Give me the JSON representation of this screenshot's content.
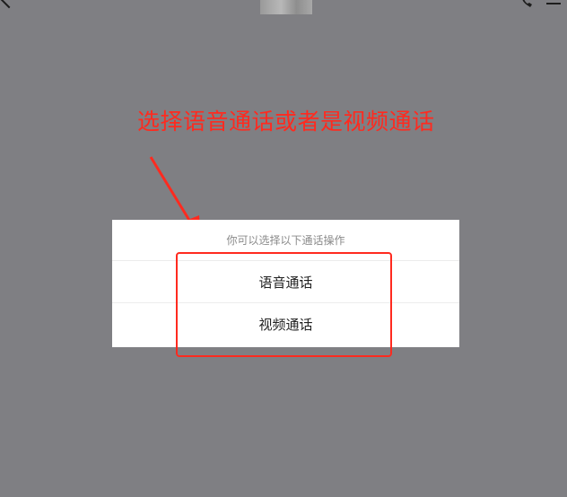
{
  "annotation": {
    "text": "选择语音通话或者是视频通话",
    "color": "#ff2a1f"
  },
  "topbar": {
    "back_icon": "chevron-left-icon",
    "phone_icon": "phone-icon",
    "menu_icon": "menu-icon"
  },
  "action_sheet": {
    "title": "你可以选择以下通话操作",
    "options": [
      {
        "label": "语音通话"
      },
      {
        "label": "视频通话"
      }
    ]
  },
  "colors": {
    "overlay": "#7f7f83",
    "sheet_bg": "#ffffff",
    "highlight": "#ff2a1f"
  }
}
